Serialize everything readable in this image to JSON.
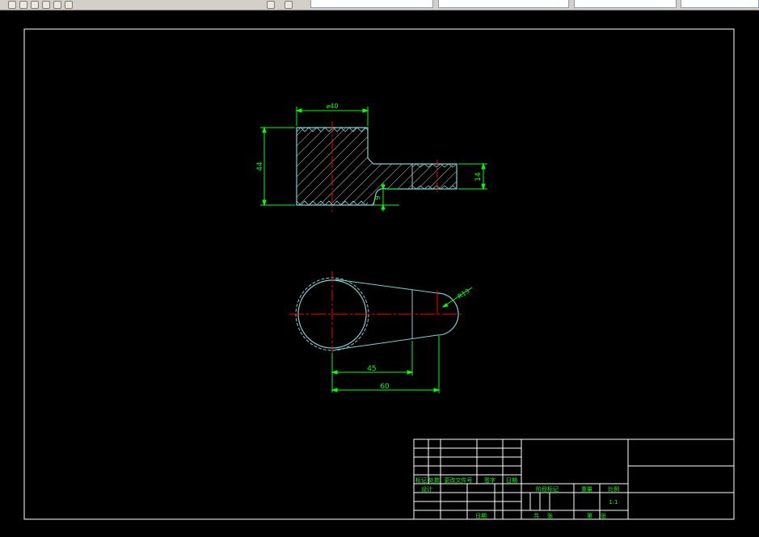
{
  "colors": {
    "background": "#000000",
    "frame": "#ffffff",
    "geometry": "#7fd0d0",
    "dimension": "#00ff00",
    "centerline": "#ff0000",
    "hatch": "#ffffff",
    "title_text": "#00ff00"
  },
  "drawing": {
    "front_view": {
      "dim_width": "⌀40",
      "dim_height": "44",
      "dim_thickness": "14",
      "dim_step": "9"
    },
    "top_view": {
      "dim_radius": "R13",
      "dim_center_distance": "45",
      "dim_overall": "60"
    }
  },
  "title_block": {
    "rev_col1": "标记",
    "rev_col2": "处数",
    "rev_col3": "更改文件号",
    "rev_col4": "签字",
    "rev_col5": "日期",
    "designer_label": "设计",
    "date_label": "日期",
    "stage_label": "阶段标记",
    "weight_label": "重量",
    "scale_label": "比例",
    "scale_value": "1:1",
    "sheets_total_label": "共张",
    "sheet_label": "第张"
  }
}
